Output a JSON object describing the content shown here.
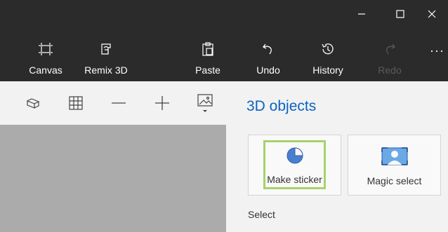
{
  "window_controls": {
    "minimize_icon": "minimize-icon",
    "maximize_icon": "maximize-icon",
    "close_icon": "close-icon"
  },
  "toolbar": {
    "canvas_label": "Canvas",
    "remix3d_label": "Remix 3D",
    "paste_label": "Paste",
    "undo_label": "Undo",
    "history_label": "History",
    "redo_label": "Redo",
    "more_label": "···"
  },
  "tools": {
    "view_icon": "3d-view-icon",
    "grid_icon": "grid-icon",
    "zoom_out_icon": "minus-icon",
    "zoom_in_icon": "plus-icon",
    "image_icon": "image-dropdown-icon"
  },
  "panel": {
    "title": "3D objects",
    "cards": [
      {
        "label": "Make sticker",
        "icon": "sticker-icon",
        "selected": true
      },
      {
        "label": "Magic select",
        "icon": "magic-select-icon",
        "selected": false
      }
    ],
    "section_label": "Select"
  },
  "colors": {
    "titlebar": "#2b2b2b",
    "accent": "#0a63c2",
    "selection": "#a6d36b",
    "canvas": "#ababab"
  }
}
